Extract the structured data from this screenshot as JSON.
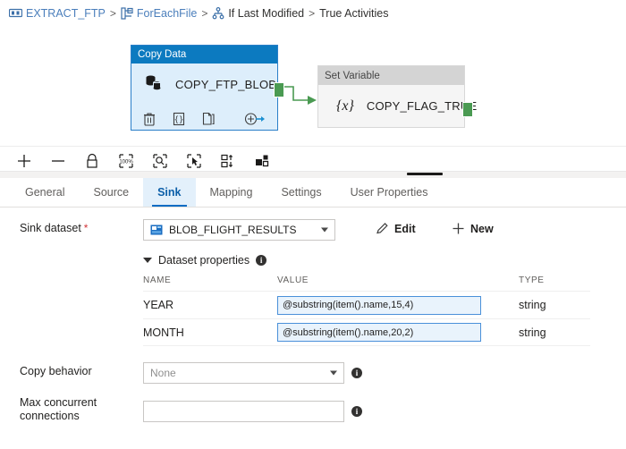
{
  "breadcrumb": {
    "items": [
      {
        "label": "EXTRACT_FTP",
        "icon": "pipeline-icon",
        "link": true
      },
      {
        "label": "ForEachFile",
        "icon": "foreach-icon",
        "link": true
      },
      {
        "label": "If Last Modified",
        "icon": "if-condition-icon",
        "link": true
      },
      {
        "label": "True Activities",
        "icon": "",
        "link": false
      }
    ],
    "separator": ">"
  },
  "canvas": {
    "activities": [
      {
        "type_label": "Copy Data",
        "name": "COPY_FTP_BLOB",
        "icon": "copy-data-icon",
        "selected": true,
        "actions": [
          {
            "name": "delete-icon",
            "label": "Delete"
          },
          {
            "name": "code-icon",
            "label": "Code"
          },
          {
            "name": "clone-icon",
            "label": "Clone"
          },
          {
            "name": "add-output-icon",
            "label": "Add output"
          }
        ]
      },
      {
        "type_label": "Set Variable",
        "name": "COPY_FLAG_TRUE",
        "icon": "variable-icon",
        "icon_glyph": "{x}",
        "selected": false,
        "actions": []
      }
    ],
    "connector_color": "#4a9a52"
  },
  "toolbar": {
    "buttons": [
      {
        "name": "zoom-in-button",
        "label": "Zoom in",
        "icon": "plus-icon"
      },
      {
        "name": "zoom-out-button",
        "label": "Zoom out",
        "icon": "minus-icon"
      },
      {
        "name": "lock-button",
        "label": "Lock canvas",
        "icon": "lock-icon"
      },
      {
        "name": "zoom-100-button",
        "label": "Zoom to 100%",
        "icon": "zoom-100-icon"
      },
      {
        "name": "zoom-to-fit-button",
        "label": "Zoom to fit",
        "icon": "zoom-fit-icon"
      },
      {
        "name": "select-button",
        "label": "Select",
        "icon": "pointer-select-icon"
      },
      {
        "name": "auto-align-button",
        "label": "Auto align",
        "icon": "auto-align-icon"
      },
      {
        "name": "layout-button",
        "label": "Layout",
        "icon": "layout-icon"
      }
    ]
  },
  "tabs": [
    {
      "label": "General",
      "active": false
    },
    {
      "label": "Source",
      "active": false
    },
    {
      "label": "Sink",
      "active": true
    },
    {
      "label": "Mapping",
      "active": false
    },
    {
      "label": "Settings",
      "active": false
    },
    {
      "label": "User Properties",
      "active": false
    }
  ],
  "form": {
    "sink_dataset": {
      "label": "Sink dataset",
      "required_marker": "*",
      "value": "BLOB_FLIGHT_RESULTS",
      "icon": "blob-dataset-icon",
      "edit_label": "Edit",
      "new_label": "New"
    },
    "dataset_properties": {
      "section_label": "Dataset properties",
      "columns": {
        "name": "NAME",
        "value": "VALUE",
        "type": "TYPE"
      },
      "rows": [
        {
          "name": "YEAR",
          "value": "@substring(item().name,15,4)",
          "type": "string"
        },
        {
          "name": "MONTH",
          "value": "@substring(item().name,20,2)",
          "type": "string"
        }
      ]
    },
    "copy_behavior": {
      "label": "Copy behavior",
      "value": "None"
    },
    "max_concurrent_connections": {
      "label_line1": "Max concurrent",
      "label_line2": "connections",
      "value": "",
      "placeholder": ""
    }
  },
  "colors": {
    "accent_blue": "#0c7ac0",
    "selected_fill": "#ddeefb",
    "connector_green": "#4a9a52",
    "tab_active": "#0a6cc4",
    "required_red": "#d13438",
    "expr_field_bg": "#e9f3fc",
    "expr_field_border": "#4a90d9"
  }
}
